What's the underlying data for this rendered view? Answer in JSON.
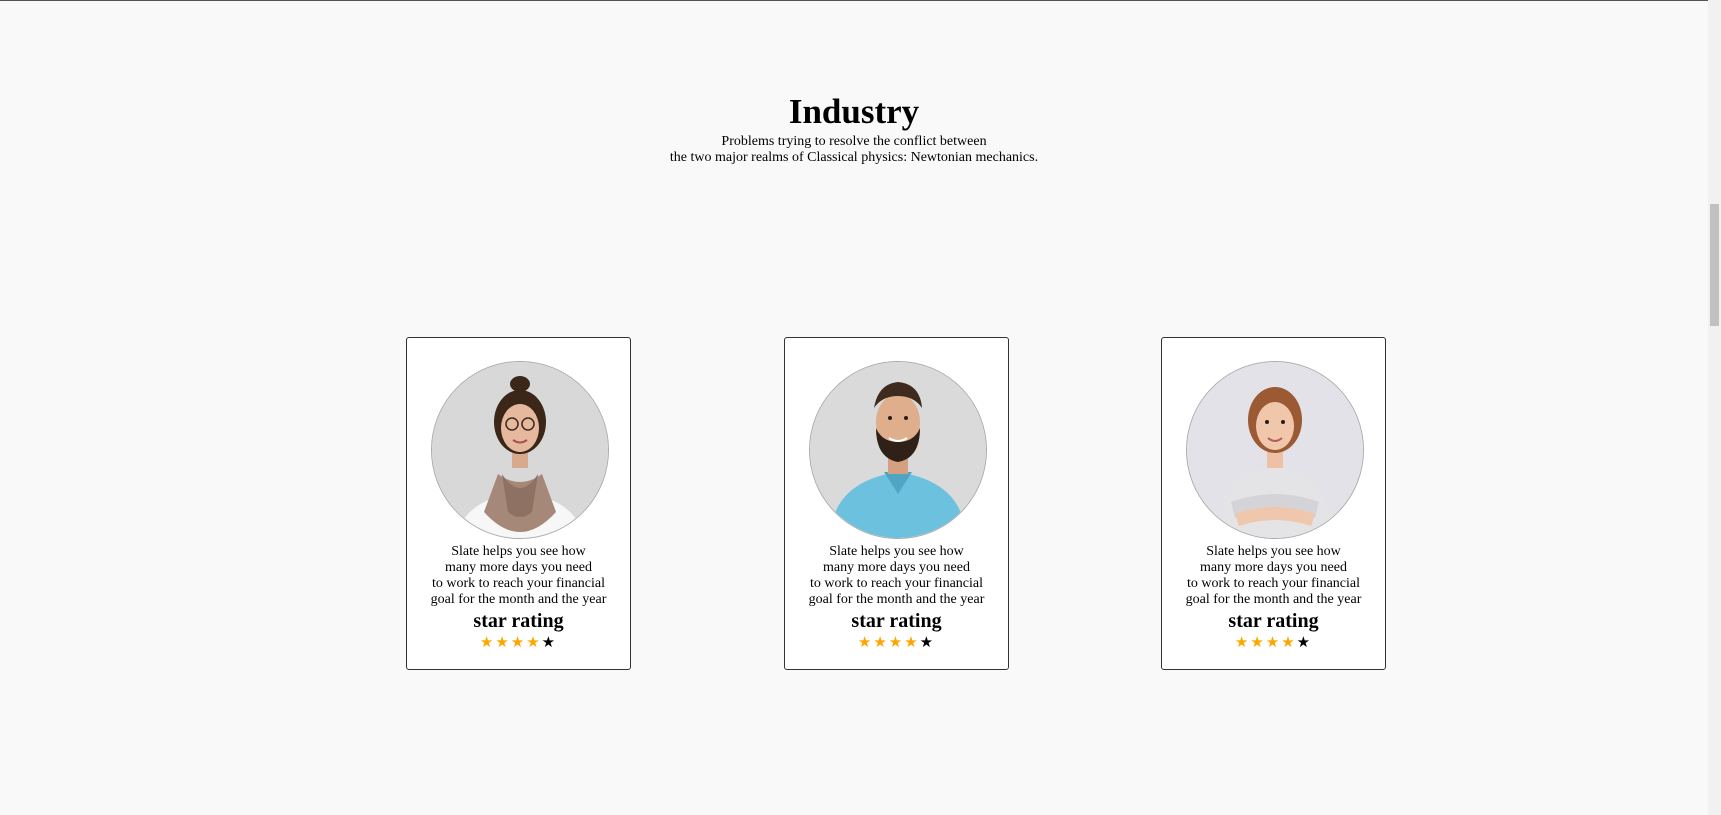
{
  "header": {
    "title": "Industry",
    "subtitle_line1": "Problems trying to resolve the conflict between",
    "subtitle_line2": "the two major realms of Classical physics: Newtonian mechanics."
  },
  "cards": [
    {
      "person": "woman-with-scarf",
      "text_lines": [
        "Slate helps you see how",
        "many more days you need",
        "to work to reach your financial",
        "goal for the month and the year"
      ],
      "rating_title": "star rating",
      "rating": 4,
      "rating_max": 5
    },
    {
      "person": "bearded-man",
      "text_lines": [
        "Slate helps you see how",
        "many more days you need",
        "to work to reach your financial",
        "goal for the month and the year"
      ],
      "rating_title": "star rating",
      "rating": 4,
      "rating_max": 5
    },
    {
      "person": "woman-crossed-arms",
      "text_lines": [
        "Slate helps you see how",
        "many more days you need",
        "to work to reach your financial",
        "goal for the month and the year"
      ],
      "rating_title": "star rating",
      "rating": 4,
      "rating_max": 5
    }
  ],
  "colors": {
    "background": "#f9f9f9",
    "star_filled": "#ffa500",
    "star_empty": "#000000"
  }
}
